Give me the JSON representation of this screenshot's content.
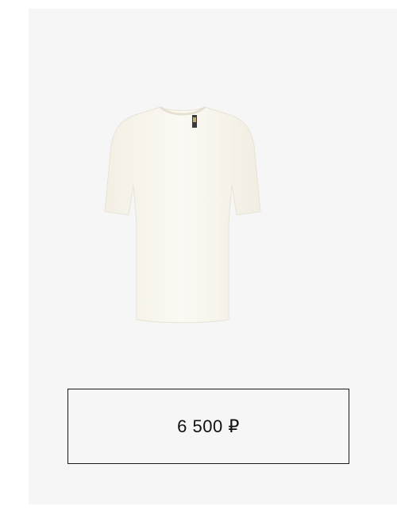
{
  "product": {
    "image_icon": "tshirt-icon",
    "image_color": "#f8f5ec",
    "price": "6 500 ₽"
  }
}
